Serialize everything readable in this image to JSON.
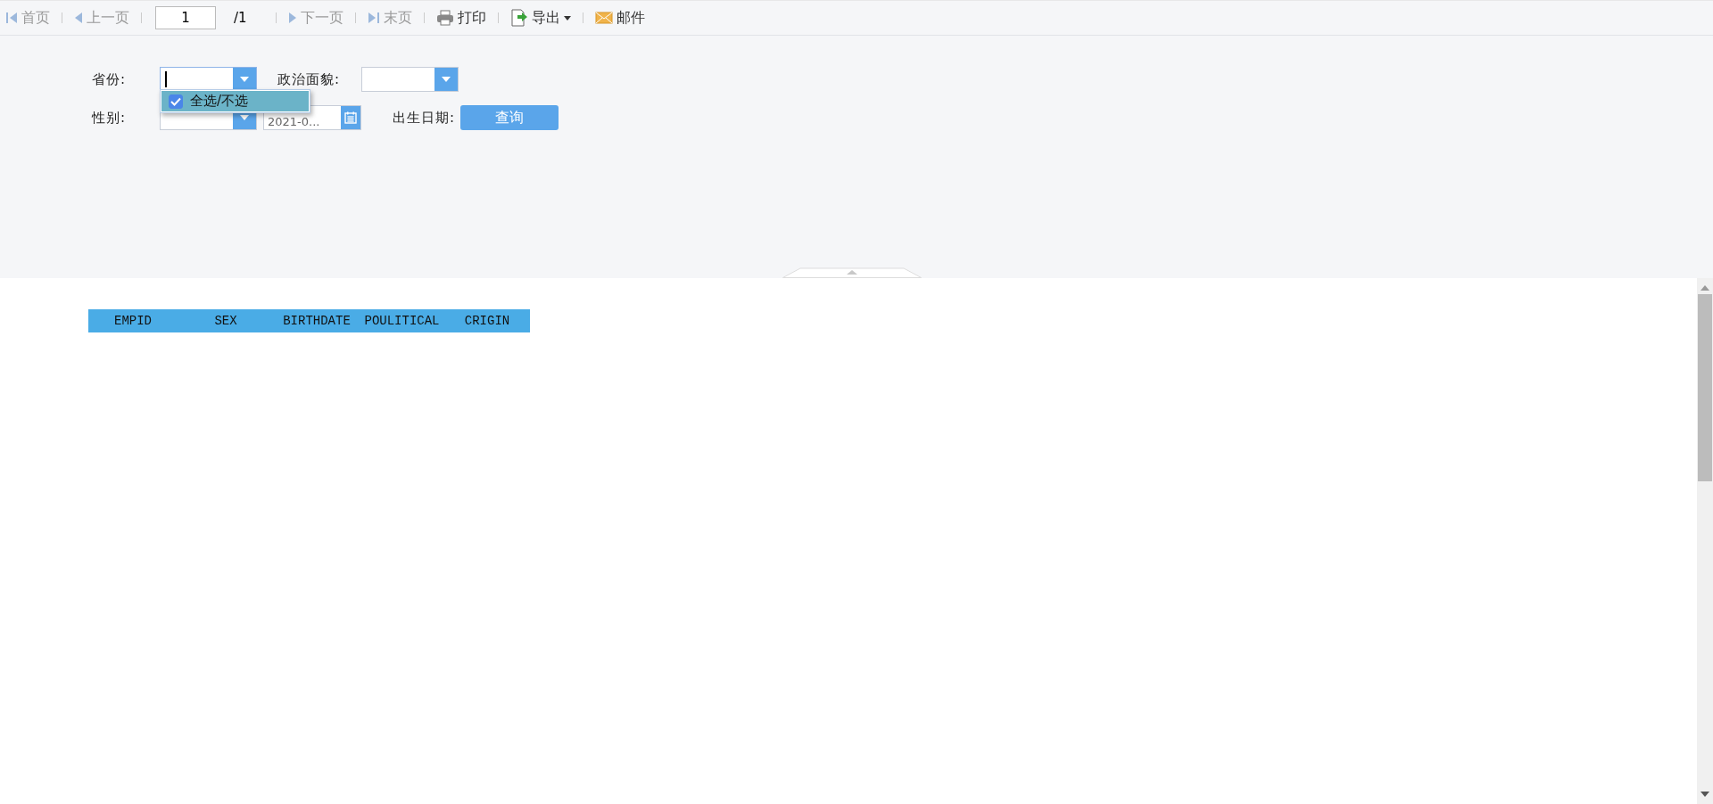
{
  "toolbar": {
    "items": [
      {
        "kind": "nav",
        "label": "首页",
        "disabled": true
      },
      {
        "kind": "nav",
        "label": "上一页",
        "disabled": true
      },
      {
        "kind": "page",
        "value": "1",
        "total": "/1"
      },
      {
        "kind": "nav",
        "label": "下一页",
        "disabled": true
      },
      {
        "kind": "nav",
        "label": "末页",
        "disabled": true
      },
      {
        "kind": "nav",
        "label": "打印",
        "disabled": false
      },
      {
        "kind": "menu",
        "label": "导出",
        "disabled": false
      },
      {
        "kind": "nav",
        "label": "邮件",
        "disabled": false
      }
    ]
  },
  "form": {
    "rows": [
      [
        {
          "label": "省份:",
          "kind": "combo",
          "focused": true
        },
        {
          "label": "政治面貌:",
          "kind": "combo",
          "focused": false
        }
      ],
      [
        {
          "label": "性别:",
          "kind": "combo",
          "focused": false
        },
        {
          "kind": "date",
          "value": "2021-0..."
        },
        {
          "label": "出生日期:",
          "kind": "none"
        },
        {
          "label": "查询",
          "kind": "button"
        }
      ]
    ],
    "dropdown": {
      "items": [
        {
          "label": "全选/不选",
          "checked": true
        }
      ]
    }
  },
  "table": {
    "columns": [
      "EMPID",
      "SEX",
      "BIRTHDATE",
      "POULITICAL",
      "CRIGIN"
    ]
  }
}
